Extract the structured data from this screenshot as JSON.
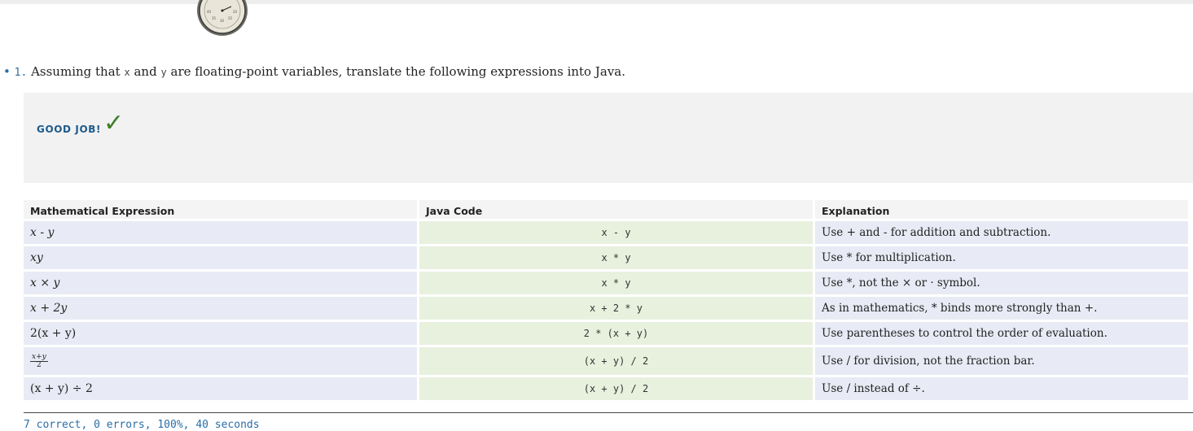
{
  "question": {
    "bullet": "•",
    "number": "1.",
    "text_before": "Assuming that",
    "var_x": "x",
    "text_and": "and",
    "var_y": "y",
    "text_after": "are floating-point variables, translate the following expressions into Java."
  },
  "feedback": {
    "label": "GOOD JOB!",
    "check_glyph": "✓"
  },
  "table": {
    "headers": [
      "Mathematical Expression",
      "Java Code",
      "Explanation"
    ],
    "rows": [
      {
        "math": "x - y",
        "code": "x - y",
        "explanation": "Use + and - for addition and subtraction."
      },
      {
        "math": "xy",
        "code": "x * y",
        "explanation": "Use * for multiplication."
      },
      {
        "math": "x × y",
        "code": "x * y",
        "explanation": "Use *, not the × or · symbol."
      },
      {
        "math": "x + 2y",
        "code": "x + 2 * y",
        "explanation": "As in mathematics, * binds more strongly than +."
      },
      {
        "math": "2(x + y)",
        "code": "2 * (x + y)",
        "explanation": "Use parentheses to control the order of evaluation."
      },
      {
        "math_num": "x+y",
        "math_den": "2",
        "code": "(x + y) / 2",
        "explanation": "Use / for division, not the fraction bar."
      },
      {
        "math": "(x + y) ÷ 2",
        "code": "(x + y) / 2",
        "explanation": "Use / instead of ÷."
      }
    ]
  },
  "status": "7 correct, 0 errors, 100%, 40 seconds",
  "colors": {
    "accent": "#2a6ea6",
    "good_job": "#1c5a8c",
    "check": "#3d7d27",
    "math_cell": "#e8ebf5",
    "code_cell": "#e8f1de",
    "feedback_bg": "#f2f2f2"
  },
  "icons": {
    "timer": "stopwatch-icon"
  }
}
